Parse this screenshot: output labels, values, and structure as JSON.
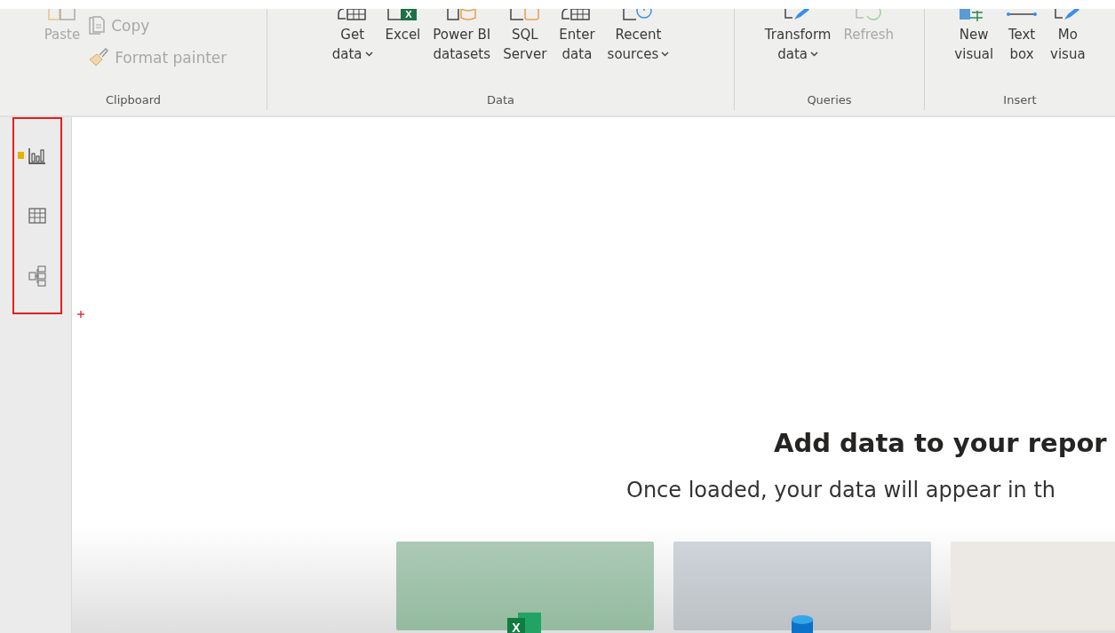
{
  "ribbon": {
    "groups": [
      {
        "label": "Clipboard",
        "buttons": [
          {
            "kind": "paste",
            "lines": [
              "Paste"
            ],
            "disabled": true,
            "dropdown": false
          }
        ],
        "small_buttons": [
          {
            "kind": "copy",
            "lines": [
              "Copy"
            ],
            "disabled": true,
            "dropdown": false
          },
          {
            "kind": "brush",
            "lines": [
              "Format painter"
            ],
            "disabled": true,
            "dropdown": false
          }
        ]
      },
      {
        "label": "Data",
        "buttons": [
          {
            "kind": "table",
            "lines": [
              "Get",
              "data"
            ],
            "disabled": false,
            "dropdown": true
          },
          {
            "kind": "excel",
            "icon_text": "X",
            "lines": [
              "Excel"
            ],
            "disabled": false,
            "dropdown": false
          },
          {
            "kind": "dataset",
            "lines": [
              "Power BI",
              "datasets"
            ],
            "disabled": false,
            "dropdown": false
          },
          {
            "kind": "sql",
            "lines": [
              "SQL",
              "Server"
            ],
            "disabled": false,
            "dropdown": false
          },
          {
            "kind": "grid",
            "lines": [
              "Enter",
              "data"
            ],
            "disabled": false,
            "dropdown": false
          },
          {
            "kind": "recent",
            "lines": [
              "Recent",
              "sources"
            ],
            "disabled": false,
            "dropdown": true
          }
        ]
      },
      {
        "label": "Queries",
        "buttons": [
          {
            "kind": "transform",
            "lines": [
              "Transform",
              "data"
            ],
            "disabled": false,
            "dropdown": true
          },
          {
            "kind": "refresh",
            "lines": [
              "Refresh"
            ],
            "disabled": true,
            "dropdown": false
          }
        ]
      },
      {
        "label": "Insert",
        "buttons": [
          {
            "kind": "visual",
            "lines": [
              "New",
              "visual"
            ],
            "disabled": false,
            "dropdown": false
          },
          {
            "kind": "textbox",
            "lines": [
              "Text",
              "box"
            ],
            "disabled": false,
            "dropdown": false
          },
          {
            "kind": "transform",
            "lines": [
              "Mo",
              "visua"
            ],
            "disabled": false,
            "dropdown": false
          }
        ]
      }
    ]
  },
  "views": [
    {
      "kind": "report",
      "selected": true
    },
    {
      "kind": "table",
      "selected": false
    },
    {
      "kind": "model",
      "selected": false
    }
  ],
  "views_highlighted": true,
  "empty_state": {
    "heading": "Add data to your repor",
    "subtitle": "Once loaded, your data will appear in th",
    "cards": [
      {
        "kind": "excel",
        "icon_text": "X"
      },
      {
        "kind": "sql"
      },
      {
        "kind": "paste"
      }
    ]
  }
}
